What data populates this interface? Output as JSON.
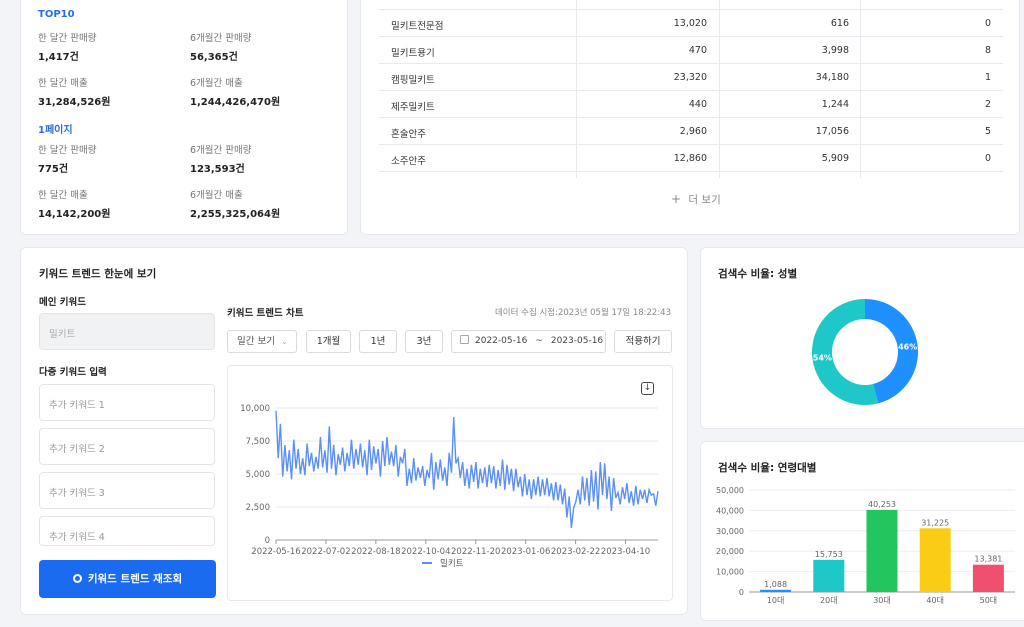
{
  "stats": {
    "top10_title": "TOP10",
    "page1_title": "1페이지",
    "top10": {
      "month_sales_label": "한 달간 판매량",
      "month_sales": "1,417건",
      "six_month_sales_label": "6개월간 판매량",
      "six_month_sales": "56,365건",
      "month_revenue_label": "한 달간 매출",
      "month_revenue": "31,284,526원",
      "six_month_revenue_label": "6개월간 매출",
      "six_month_revenue": "1,244,426,470원"
    },
    "page1": {
      "month_sales_label": "한 달간 판매량",
      "month_sales": "775건",
      "six_month_sales_label": "6개월간 판매량",
      "six_month_sales": "123,593건",
      "month_revenue_label": "한 달간 매출",
      "month_revenue": "14,142,200원",
      "six_month_revenue_label": "6개월간 매출",
      "six_month_revenue": "2,255,325,064원"
    }
  },
  "table": {
    "rows": [
      {
        "keyword": "",
        "v1": "",
        "v2": "",
        "v3": ""
      },
      {
        "keyword": "밀키트전문점",
        "v1": "13,020",
        "v2": "616",
        "v3": "0"
      },
      {
        "keyword": "밀키트용기",
        "v1": "470",
        "v2": "3,998",
        "v3": "8"
      },
      {
        "keyword": "캠핑밀키트",
        "v1": "23,320",
        "v2": "34,180",
        "v3": "1"
      },
      {
        "keyword": "제주밀키트",
        "v1": "440",
        "v2": "1,244",
        "v3": "2"
      },
      {
        "keyword": "혼술안주",
        "v1": "2,960",
        "v2": "17,056",
        "v3": "5"
      },
      {
        "keyword": "소주안주",
        "v1": "12,860",
        "v2": "5,909",
        "v3": "0"
      }
    ],
    "more_label": "더 보기",
    "more_icon": "plus-icon"
  },
  "trend": {
    "title": "키워드 트렌드 한눈에 보기",
    "main_keyword_label": "메인 키워드",
    "main_keyword_value": "밀키트",
    "multi_keyword_label": "다중 키워드 입력",
    "extra_keywords": [
      "추가 키워드 1",
      "추가 키워드 2",
      "추가 키워드 3",
      "추가 키워드 4"
    ],
    "search_button": "키워드 트렌드 재조회",
    "chart_title": "키워드 트렌드 차트",
    "collected_at": "데이터 수집 시점:2023년 05월 17일 18:22:43",
    "period_select": "일간 보기",
    "range_buttons": [
      "1개월",
      "1년",
      "3년"
    ],
    "date_start": "2022-05-16",
    "date_sep": "~",
    "date_end": "2023-05-16",
    "apply_button": "적용하기",
    "download_icon": "download-icon"
  },
  "gender": {
    "title": "검색수 비율: 성별",
    "colors": {
      "male": "#1e90ff",
      "female": "#1ec8c8"
    }
  },
  "age": {
    "title": "검색수 비율: 연령대별"
  },
  "chart_data": [
    {
      "type": "line",
      "title": "",
      "ylim": [
        0,
        10000
      ],
      "yticks": [
        "0",
        "2,500",
        "5,000",
        "7,500",
        "10,000"
      ],
      "xticks": [
        "2022-05-16",
        "2022-07-02",
        "2022-08-18",
        "2022-10-04",
        "2022-11-20",
        "2023-01-06",
        "2023-02-22",
        "2023-04-10"
      ],
      "legend": "top-bottom",
      "series": [
        {
          "name": "밀키트",
          "color": "#5b8ff9",
          "values": [
            9800,
            6200,
            8800,
            4800,
            7200,
            5200,
            6800,
            4600,
            7600,
            5400,
            6900,
            5000,
            6200,
            4900,
            7300,
            5600,
            6600,
            5200,
            6300,
            5400,
            7800,
            5500,
            6800,
            5100,
            8600,
            5400,
            7200,
            4900,
            6500,
            5700,
            7000,
            5200,
            6600,
            5600,
            7600,
            5400,
            6900,
            5700,
            7300,
            5500,
            6800,
            4900,
            7600,
            5300,
            7100,
            5800,
            6900,
            4800,
            7500,
            5600,
            7800,
            5700,
            6700,
            5600,
            7200,
            4800,
            6300,
            5800,
            6900,
            4100,
            5400,
            4300,
            6200,
            4500,
            5500,
            4700,
            5600,
            4100,
            5300,
            4700,
            6600,
            3800,
            5900,
            4600,
            6100,
            4500,
            5500,
            4100,
            6600,
            5100,
            9300,
            5800,
            6200,
            4700,
            5900,
            4100,
            5400,
            3900,
            5700,
            4400,
            5900,
            3900,
            5400,
            4300,
            5500,
            4000,
            5700,
            4300,
            5600,
            3900,
            5300,
            4100,
            6100,
            3800,
            5700,
            4200,
            5400,
            3700,
            5400,
            4000,
            4800,
            3300,
            5000,
            3400,
            4600,
            3100,
            4600,
            3400,
            4800,
            3300,
            4600,
            3400,
            4700,
            3300,
            4300,
            3000,
            4400,
            3000,
            4200,
            2700,
            3900,
            1700,
            3300,
            900,
            2400,
            2900,
            3800,
            2700,
            4800,
            3000,
            4700,
            2600,
            5300,
            2900,
            5200,
            2300,
            5900,
            3400,
            5800,
            3100,
            4800,
            2200,
            4700,
            3200,
            3600,
            2700,
            4000,
            3100,
            4300,
            2800,
            3700,
            2600,
            4100,
            2700,
            3800,
            3100,
            3800,
            2800,
            3800,
            3400,
            3500,
            2600,
            3700
          ]
        }
      ]
    },
    {
      "type": "pie",
      "title": "",
      "slices": [
        {
          "name": "남성",
          "value": 46,
          "label": "46%"
        },
        {
          "name": "여성",
          "value": 54,
          "label": "54%"
        }
      ]
    },
    {
      "type": "bar",
      "title": "",
      "categories": [
        "10대",
        "20대",
        "30대",
        "40대",
        "50대"
      ],
      "values": [
        1088,
        15753,
        40253,
        31225,
        13381
      ],
      "value_labels": [
        "1,088",
        "15,753",
        "40,253",
        "31,225",
        "13,381"
      ],
      "colors": [
        "#1e90ff",
        "#1ec8c8",
        "#22c55e",
        "#facc15",
        "#f0506e"
      ],
      "ylim": [
        0,
        50000
      ],
      "yticks": [
        "0",
        "10,000",
        "20,000",
        "30,000",
        "40,000",
        "50,000"
      ]
    }
  ]
}
